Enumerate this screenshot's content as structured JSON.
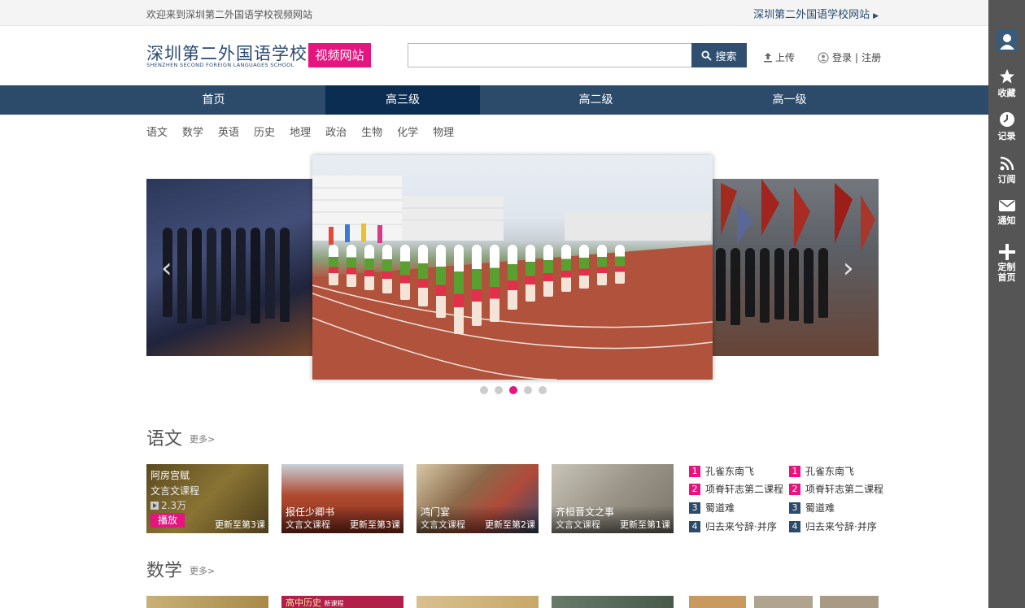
{
  "topbar": {
    "welcome": "欢迎来到深圳第二外国语学校视频网站",
    "site_link": "深圳第二外国语学校网站",
    "site_link_arrow": "▶"
  },
  "header": {
    "logo_cn": "深圳第二外国语学校",
    "logo_en": "SHENZHEN SECOND FOREIGN LANGUAGES SCHOOL",
    "badge": "视频网站",
    "search_placeholder": "",
    "search_button": "搜索",
    "upload": "上传",
    "login": "登录",
    "separator": "|",
    "register": "注册"
  },
  "nav": {
    "items": [
      {
        "label": "首页",
        "active": false
      },
      {
        "label": "高三级",
        "active": true
      },
      {
        "label": "高二级",
        "active": false
      },
      {
        "label": "高一级",
        "active": false
      }
    ]
  },
  "subjects": [
    "语文",
    "数学",
    "英语",
    "历史",
    "地理",
    "政治",
    "生物",
    "化学",
    "物理"
  ],
  "carousel": {
    "prev_icon": "‹",
    "next_icon": "›",
    "dots": [
      false,
      false,
      true,
      false,
      false
    ]
  },
  "sections": [
    {
      "title": "语文",
      "more": "更多>",
      "cards": [
        {
          "title": "阿房宫赋",
          "sub": "文言文课程",
          "views": "2.3万",
          "play": "播放",
          "update": "更新至第3课",
          "bg": "#6e5a2a"
        },
        {
          "title": "报任少卿书",
          "sub": "文言文课程",
          "update": "更新至第3课",
          "bg": "#a04a32"
        },
        {
          "title": "鸿门宴",
          "sub": "文言文课程",
          "update": "更新至第2课",
          "bg": "#8a6a4a"
        },
        {
          "title": "齐桓晋文之事",
          "sub": "文言文课程",
          "update": "更新至第1课",
          "bg": "#a09a88"
        }
      ],
      "ranks_left": [
        {
          "num": "1",
          "label": "孔雀东南飞",
          "hot": true
        },
        {
          "num": "2",
          "label": "项脊轩志第二课程",
          "hot": true
        },
        {
          "num": "3",
          "label": "蜀道难",
          "hot": false
        },
        {
          "num": "4",
          "label": "归去来兮辞·并序",
          "hot": false
        }
      ],
      "ranks_right": [
        {
          "num": "1",
          "label": "孔雀东南飞",
          "hot": true
        },
        {
          "num": "2",
          "label": "项脊轩志第二课程",
          "hot": true
        },
        {
          "num": "3",
          "label": "蜀道难",
          "hot": false
        },
        {
          "num": "4",
          "label": "归去来兮辞·并序",
          "hot": false
        }
      ]
    },
    {
      "title": "数学",
      "more": "更多>",
      "thumb_text": "高中历史",
      "thumb_sub": "新课程"
    }
  ],
  "sidebar": {
    "items": [
      {
        "label": "收藏",
        "icon": "star-icon"
      },
      {
        "label": "记录",
        "icon": "clock-icon"
      },
      {
        "label": "订阅",
        "icon": "rss-icon"
      },
      {
        "label": "通知",
        "icon": "mail-icon"
      },
      {
        "label": "定制首页",
        "icon": "plus-icon"
      }
    ]
  },
  "colors": {
    "brand": "#2c4a6a",
    "nav_active": "#0c2d52",
    "accent": "#e5147e",
    "sidebar": "#555555"
  }
}
